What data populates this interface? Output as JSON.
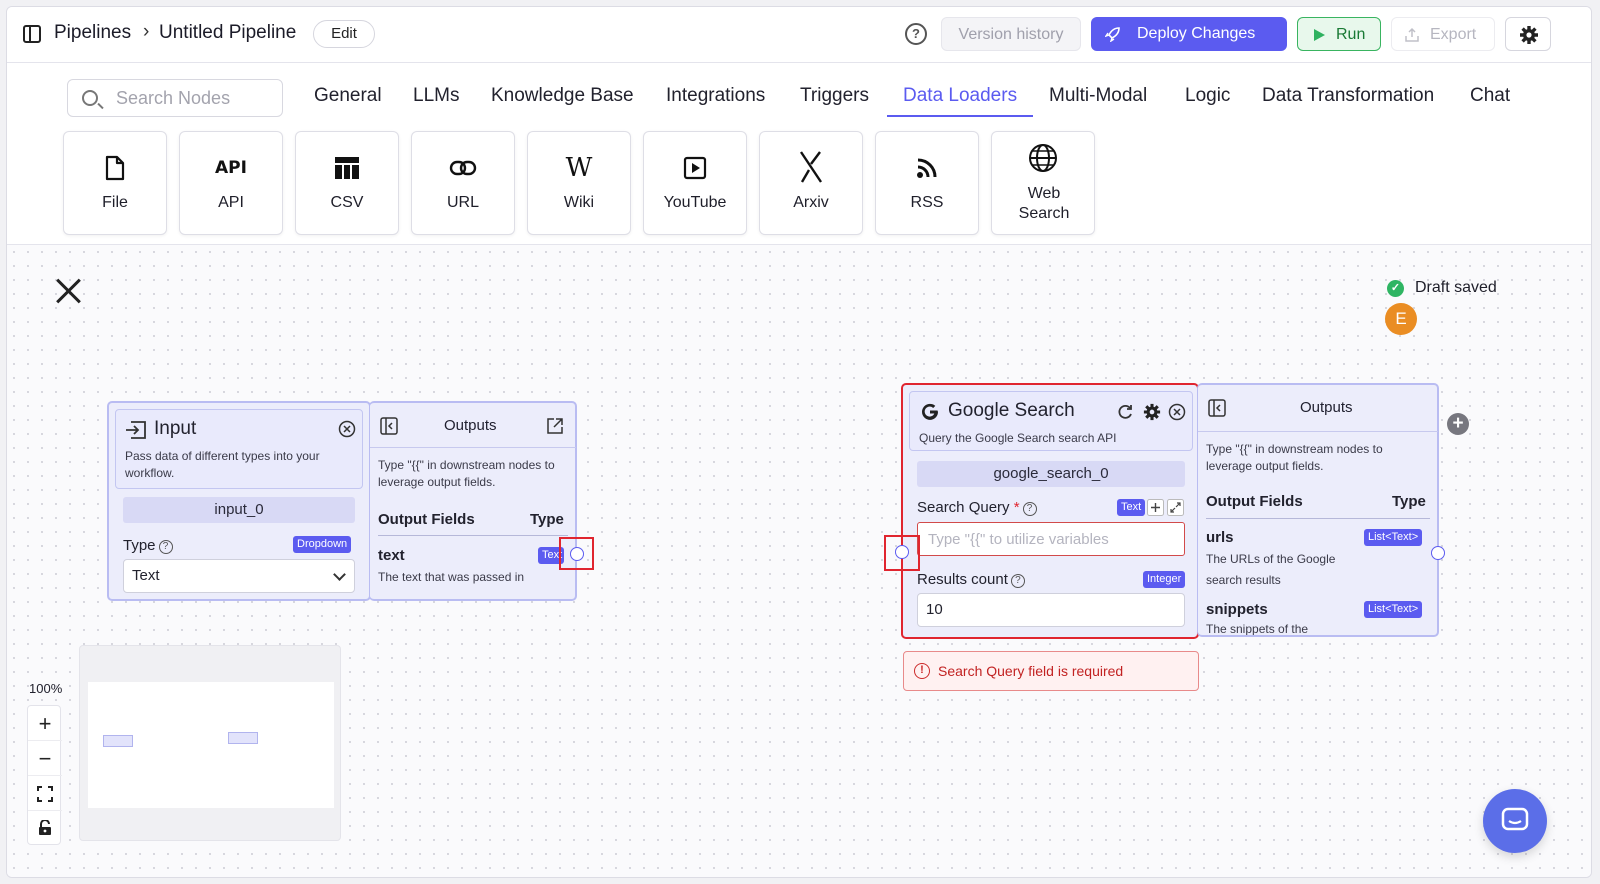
{
  "header": {
    "breadcrumb_root": "Pipelines",
    "breadcrumb_sep": "›",
    "breadcrumb_current": "Untitled Pipeline",
    "edit_label": "Edit",
    "help_glyph": "?",
    "version_history_label": "Version history",
    "deploy_label": "Deploy Changes",
    "run_label": "Run",
    "export_label": "Export"
  },
  "toolbar": {
    "search_placeholder": "Search Nodes",
    "tabs": [
      "General",
      "LLMs",
      "Knowledge Base",
      "Integrations",
      "Triggers",
      "Data Loaders",
      "Multi-Modal",
      "Logic",
      "Data Transformation",
      "Chat"
    ],
    "active_tab": "Data Loaders",
    "tiles": [
      {
        "label": "File",
        "icon": "file-icon"
      },
      {
        "label": "API",
        "icon": "api-icon"
      },
      {
        "label": "CSV",
        "icon": "table-icon"
      },
      {
        "label": "URL",
        "icon": "link-icon"
      },
      {
        "label": "Wiki",
        "icon": "wikipedia-icon"
      },
      {
        "label": "YouTube",
        "icon": "play-icon"
      },
      {
        "label": "Arxiv",
        "icon": "arxiv-icon"
      },
      {
        "label": "RSS",
        "icon": "rss-icon"
      },
      {
        "label": "Web Search",
        "icon": "globe-icon"
      }
    ],
    "api_glyph": "API",
    "wiki_glyph": "W"
  },
  "canvas": {
    "draft_status": "Draft saved",
    "avatar_initial": "E",
    "zoom_label": "100%",
    "zoom_in": "+",
    "zoom_out": "−"
  },
  "input_node": {
    "title": "Input",
    "description": "Pass data of different types into your workflow.",
    "id": "input_0",
    "type_label": "Type",
    "type_badge": "Dropdown",
    "type_value": "Text",
    "outputs_title": "Outputs",
    "outputs_desc": "Type \"{{\" in downstream nodes to leverage output fields.",
    "output_fields_header": "Output Fields",
    "type_header": "Type",
    "output_name": "text",
    "output_type": "Text",
    "output_desc": "The text that was passed in"
  },
  "google_node": {
    "title": "Google Search",
    "description": "Query the Google Search search API",
    "id": "google_search_0",
    "query_label": "Search Query",
    "required_mark": "*",
    "query_badge": "Text",
    "query_placeholder": "Type \"{{\" to utilize variables",
    "count_label": "Results count",
    "count_badge": "Integer",
    "count_value": "10",
    "error_text": "Search Query field is required",
    "outputs_title": "Outputs",
    "outputs_desc": "Type \"{{\" in downstream nodes to leverage output fields.",
    "output_fields_header": "Output Fields",
    "type_header": "Type",
    "outputs": [
      {
        "name": "urls",
        "type": "List<Text>",
        "desc": "The URLs of the Google search results"
      },
      {
        "name": "snippets",
        "type": "List<Text>",
        "desc": "The snippets of the"
      }
    ]
  },
  "colors": {
    "accent": "#5b5bf0",
    "run_green": "#39b460",
    "error_red": "#e0252f",
    "avatar": "#ea8d23"
  }
}
